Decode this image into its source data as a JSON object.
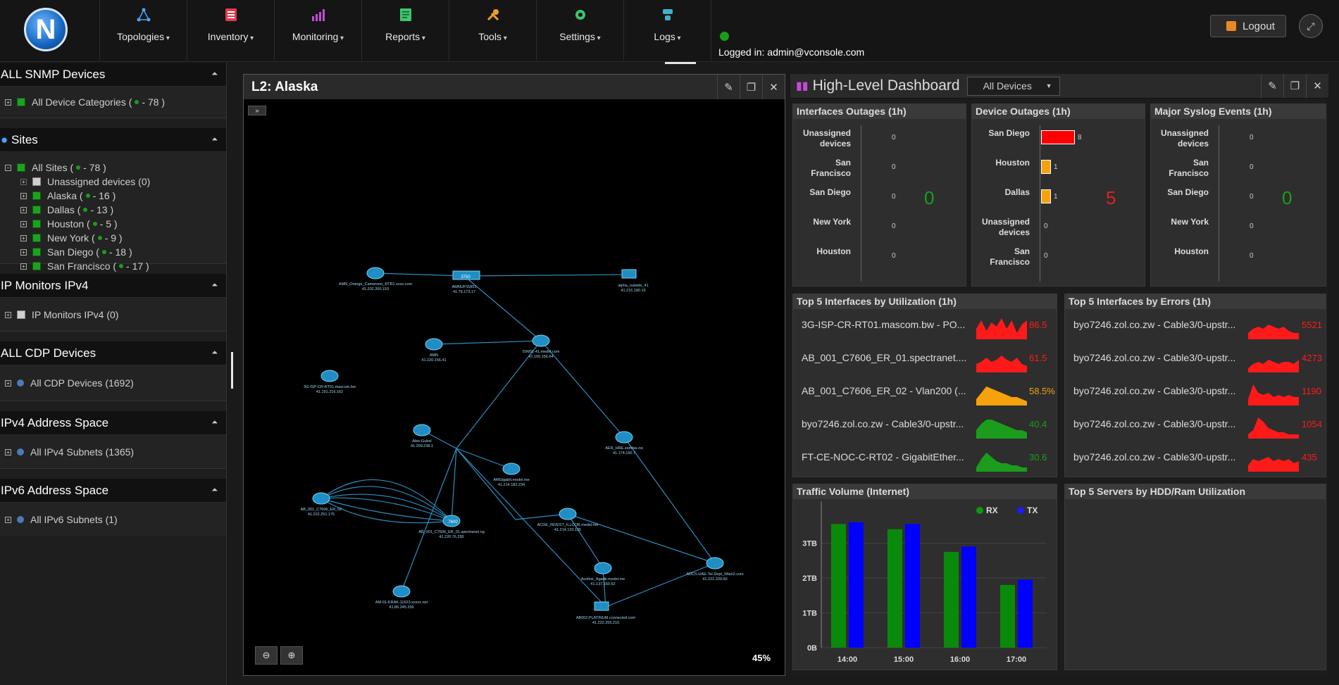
{
  "nav": {
    "logo_letter": "N",
    "items": [
      {
        "label": "Topologies",
        "icon": "topology-icon"
      },
      {
        "label": "Inventory",
        "icon": "inventory-icon"
      },
      {
        "label": "Monitoring",
        "icon": "monitoring-icon"
      },
      {
        "label": "Reports",
        "icon": "reports-icon"
      },
      {
        "label": "Tools",
        "icon": "tools-icon"
      },
      {
        "label": "Settings",
        "icon": "settings-icon"
      },
      {
        "label": "Logs",
        "icon": "logs-icon"
      }
    ],
    "logged_in": "Logged in: admin@vconsole.com",
    "logout": "Logout"
  },
  "sidebar": {
    "snmp": {
      "title": "ALL SNMP Devices",
      "item": "All Device Categories (",
      "count": "- 78 )"
    },
    "sites": {
      "title": "Sites",
      "root": {
        "label": "All Sites (",
        "count": "- 78 )"
      },
      "unassigned": "Unassigned devices (0)",
      "items": [
        {
          "label": "Alaska (",
          "count": "- 16 )"
        },
        {
          "label": "Dallas (",
          "count": "- 13 )"
        },
        {
          "label": "Houston (",
          "count": "- 5 )"
        },
        {
          "label": "New York (",
          "count": "- 9 )"
        },
        {
          "label": "San Diego (",
          "count": "- 18 )"
        },
        {
          "label": "San Francisco (",
          "count": "- 17 )"
        }
      ]
    },
    "ipmon": {
      "title": "IP Monitors IPv4",
      "item": "IP Monitors IPv4 (0)"
    },
    "cdp": {
      "title": "ALL CDP Devices",
      "item": "All CDP Devices (1692)"
    },
    "ipv4": {
      "title": "IPv4 Address Space",
      "item": "All IPv4 Subnets (1365)"
    },
    "ipv6": {
      "title": "IPv6 Address Space",
      "item": "All IPv6 Subnets (1)"
    }
  },
  "map": {
    "title": "L2: Alaska",
    "expand": "»",
    "zoom": "45%",
    "nodes": [
      {
        "id": "n1",
        "label": "AMN_Orange_Cameroon_RTR1.xxxx.com",
        "ip": "41.202.200.153"
      },
      {
        "id": "n2",
        "label": "AMNUPSW01",
        "ip": "41.79.173.17",
        "tag": "3750"
      },
      {
        "id": "n3",
        "label": "alpha_outside_41",
        "ip": "41.216.180.15"
      },
      {
        "id": "n4",
        "label": "3G-ISP-CR-RT01.mascom.bw",
        "ip": "41.191.216.162"
      },
      {
        "id": "n5",
        "label": "AMN",
        "ip": "41.220.156.41"
      },
      {
        "id": "n6",
        "label": "ISW01-41.medel.com",
        "ip": "41.160.156.64"
      },
      {
        "id": "n7",
        "label": "Abis-Gubel",
        "ip": "41.209.238.1"
      },
      {
        "id": "n8",
        "label": "AMGigabit.medel.me",
        "ip": "41.214.182.234"
      },
      {
        "id": "n9",
        "label": "AER_HRE.zambia.zw",
        "ip": "41.174.160.7"
      },
      {
        "id": "n10",
        "label": "AB_001_C7606_ER_02",
        "ip": "41.222.251.175"
      },
      {
        "id": "n11",
        "label": "AB_001_C7606_ER_01.spectranet.ng",
        "ip": "41.220.76.250",
        "tag": "7600"
      },
      {
        "id": "n12",
        "label": "ACDE_INVEST_ILLCOR.medel.me",
        "ip": "41.214.120.126"
      },
      {
        "id": "n13",
        "label": "Acoline_Agadir.medel.me",
        "ip": "41.137.160.62"
      },
      {
        "id": "n14",
        "label": "ADCS-UAE-Tel-Dept_Wlan2.com",
        "ip": "41.222.209.60"
      },
      {
        "id": "n15",
        "label": "AM-01-KRAK-11623.xxxxx.net",
        "ip": "41.86.245.206"
      },
      {
        "id": "n16",
        "label": "AB002.PLATINUM.connected.com",
        "ip": "41.222.255.210"
      }
    ]
  },
  "dashboard": {
    "title": "High-Level Dashboard",
    "filter": "All Devices",
    "interfaces_outages": {
      "title": "Interfaces Outages (1h)",
      "rows": [
        {
          "name": "Unassigned devices",
          "value": "0"
        },
        {
          "name": "San Francisco",
          "value": "0"
        },
        {
          "name": "San Diego",
          "value": "0"
        },
        {
          "name": "New York",
          "value": "0"
        },
        {
          "name": "Houston",
          "value": "0"
        }
      ],
      "total": "0"
    },
    "device_outages": {
      "title": "Device Outages (1h)",
      "rows": [
        {
          "name": "San Diego",
          "value": "8",
          "level": 8,
          "color": "#ff0000"
        },
        {
          "name": "Houston",
          "value": "1",
          "level": 1,
          "color": "#f5a20d"
        },
        {
          "name": "Dallas",
          "value": "1",
          "level": 1,
          "color": "#f5a20d"
        },
        {
          "name": "Unassigned devices",
          "value": "0",
          "level": 0,
          "color": "#f5a20d"
        },
        {
          "name": "San Francisco",
          "value": "0",
          "level": 0,
          "color": "#f5a20d"
        }
      ],
      "total": "5"
    },
    "syslog": {
      "title": "Major Syslog Events (1h)",
      "rows": [
        {
          "name": "Unassigned devices",
          "value": "0"
        },
        {
          "name": "San Francisco",
          "value": "0"
        },
        {
          "name": "San Diego",
          "value": "0"
        },
        {
          "name": "New York",
          "value": "0"
        },
        {
          "name": "Houston",
          "value": "0"
        }
      ],
      "total": "0"
    },
    "top_util": {
      "title": "Top 5 Interfaces by Utilization (1h)",
      "rows": [
        {
          "name": "3G-ISP-CR-RT01.mascom.bw - PO...",
          "value": "86.5",
          "color": "#ff1a1a"
        },
        {
          "name": "AB_001_C7606_ER_01.spectranet....",
          "value": "61.5",
          "color": "#ff1a1a"
        },
        {
          "name": "AB_001_C7606_ER_02 - Vlan200 (...",
          "value": "58.5%",
          "color": "#f5a20d"
        },
        {
          "name": "byo7246.zol.co.zw - Cable3/0-upstr...",
          "value": "40.4",
          "color": "#1c9c1c"
        },
        {
          "name": "FT-CE-NOC-C-RT02 - GigabitEther...",
          "value": "30.6",
          "color": "#1c9c1c"
        }
      ]
    },
    "top_err": {
      "title": "Top 5 Interfaces by Errors (1h)",
      "rows": [
        {
          "name": "byo7246.zol.co.zw - Cable3/0-upstr...",
          "value": "5521",
          "color": "#ff1a1a"
        },
        {
          "name": "byo7246.zol.co.zw - Cable3/0-upstr...",
          "value": "4273",
          "color": "#ff1a1a"
        },
        {
          "name": "byo7246.zol.co.zw - Cable3/0-upstr...",
          "value": "1190",
          "color": "#ff1a1a"
        },
        {
          "name": "byo7246.zol.co.zw - Cable3/0-upstr...",
          "value": "1054",
          "color": "#ff1a1a"
        },
        {
          "name": "byo7246.zol.co.zw - Cable3/0-upstr...",
          "value": "435",
          "color": "#ff1a1a"
        }
      ]
    },
    "traffic": {
      "title": "Traffic Volume (Internet)"
    },
    "servers": {
      "title": "Top 5 Servers by HDD/Ram Utilization"
    }
  },
  "chart_data": {
    "type": "bar",
    "categories": [
      "14:00",
      "15:00",
      "16:00",
      "17:00"
    ],
    "series": [
      {
        "name": "RX",
        "color": "#0a8a0a",
        "values": [
          3.55,
          3.4,
          2.75,
          1.8
        ]
      },
      {
        "name": "TX",
        "color": "#0000ff",
        "values": [
          3.6,
          3.55,
          2.9,
          1.95
        ]
      }
    ],
    "ylim": [
      0,
      4
    ],
    "yticks": [
      "0B",
      "1TB",
      "2TB",
      "3TB"
    ],
    "ytick_values": [
      0,
      1,
      2,
      3
    ],
    "legend": "top-right"
  }
}
